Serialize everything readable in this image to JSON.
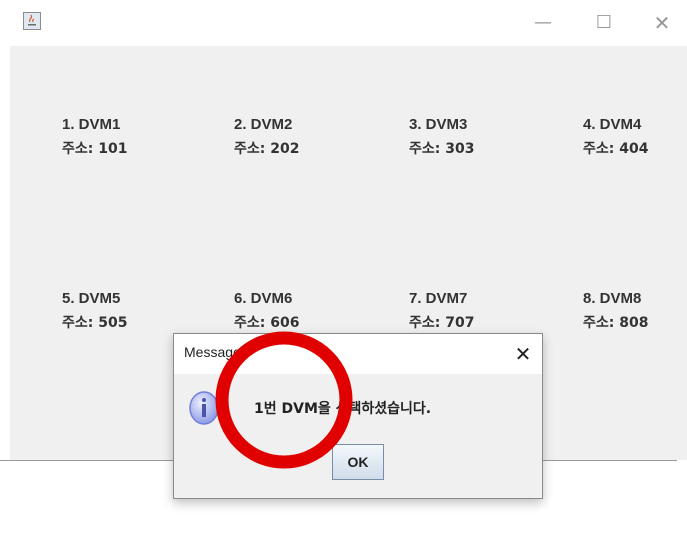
{
  "window": {
    "controls": {
      "minimize": "—",
      "maximize": "☐",
      "close": "✕"
    }
  },
  "dvms": [
    {
      "name": "1. DVM1",
      "address": "주소: 101"
    },
    {
      "name": "2. DVM2",
      "address": "주소: 202"
    },
    {
      "name": "3. DVM3",
      "address": "주소: 303"
    },
    {
      "name": "4. DVM4",
      "address": "주소: 404"
    },
    {
      "name": "5. DVM5",
      "address": "주소: 505"
    },
    {
      "name": "6. DVM6",
      "address": "주소: 606"
    },
    {
      "name": "7. DVM7",
      "address": "주소: 707"
    },
    {
      "name": "8. DVM8",
      "address": "주소: 808"
    }
  ],
  "dialog": {
    "title": "Message",
    "close": "✕",
    "message": "1번 DVM을 선택하셨습니다.",
    "ok_label": "OK",
    "icon": "info-icon"
  },
  "colors": {
    "window_bg": "#f0f0f0",
    "annotation": "#e00000",
    "info_icon": "#6f7fd8"
  }
}
